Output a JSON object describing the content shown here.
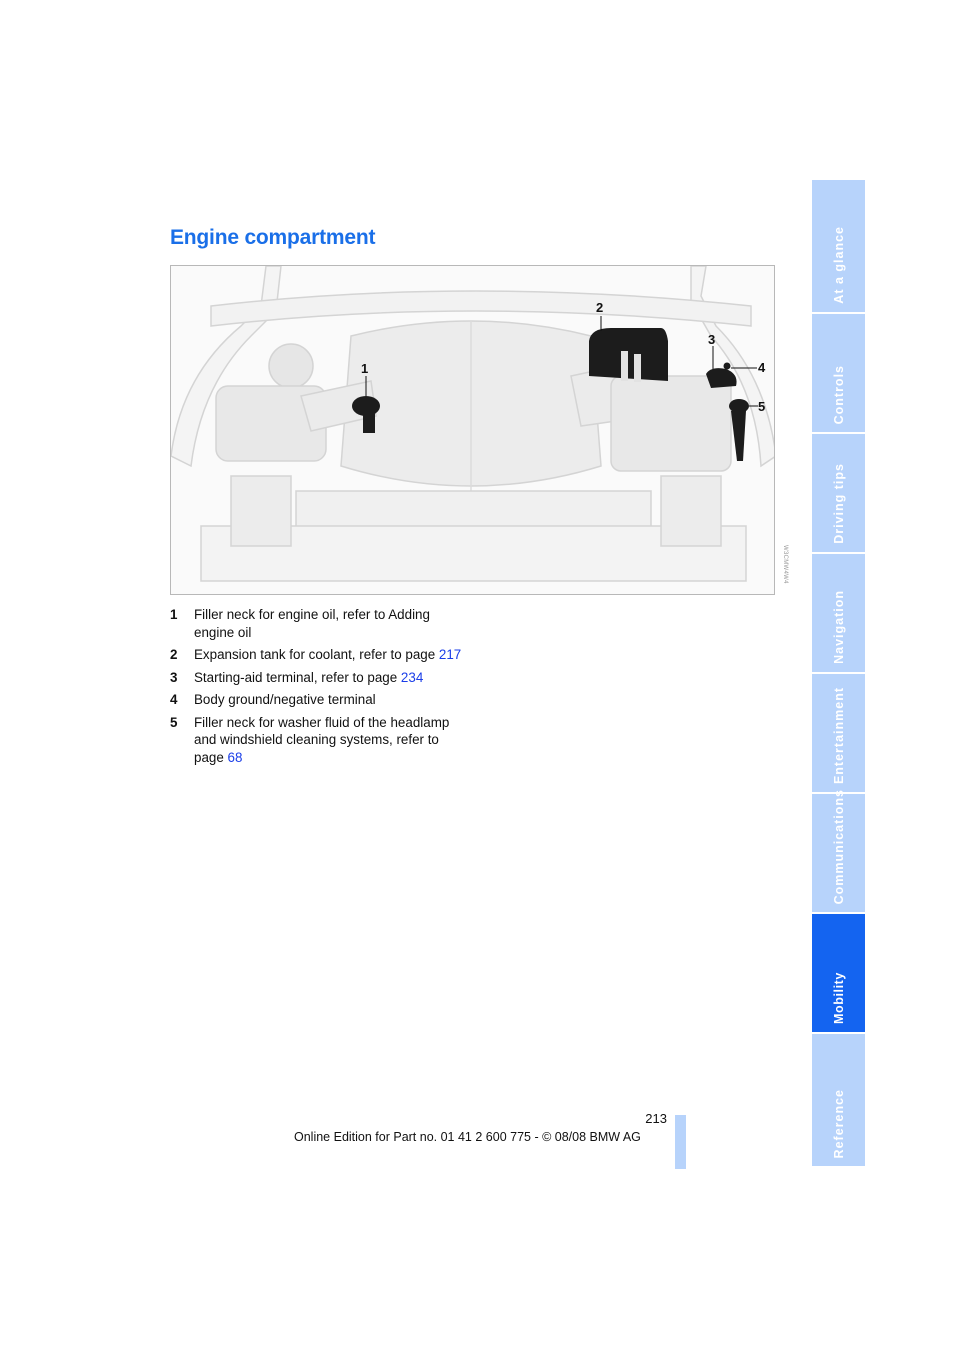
{
  "page": {
    "title": "Engine compartment",
    "page_number": "213",
    "footer": "Online Edition for Part no. 01 41 2 600 775 - © 08/08 BMW AG"
  },
  "figure": {
    "description": "Engine compartment illustration",
    "image_code": "W3CMW4W4",
    "callouts": [
      "1",
      "2",
      "3",
      "4",
      "5"
    ]
  },
  "legend": [
    {
      "num": "1",
      "text": "Filler neck for engine oil, refer to Adding engine oil",
      "link_prefix": "",
      "link": ""
    },
    {
      "num": "2",
      "text": "Expansion tank for coolant, refer to page ",
      "link": "217"
    },
    {
      "num": "3",
      "text": "Starting-aid terminal, refer to page ",
      "link": "234"
    },
    {
      "num": "4",
      "text": "Body ground/negative terminal",
      "link": ""
    },
    {
      "num": "5",
      "text": "Filler neck for washer fluid of the headlamp and windshield cleaning systems, refer to page ",
      "link": "68"
    }
  ],
  "sidebar": {
    "tabs": [
      {
        "label": "At a glance",
        "active": false
      },
      {
        "label": "Controls",
        "active": false
      },
      {
        "label": "Driving tips",
        "active": false
      },
      {
        "label": "Navigation",
        "active": false
      },
      {
        "label": "Entertainment",
        "active": false
      },
      {
        "label": "Communications",
        "active": false
      },
      {
        "label": "Mobility",
        "active": true
      },
      {
        "label": "Reference",
        "active": false
      }
    ]
  },
  "colors": {
    "title": "#1a6fe8",
    "link": "#1a3de8",
    "tab": "#b7d3fb",
    "tab_active": "#1464f0"
  }
}
